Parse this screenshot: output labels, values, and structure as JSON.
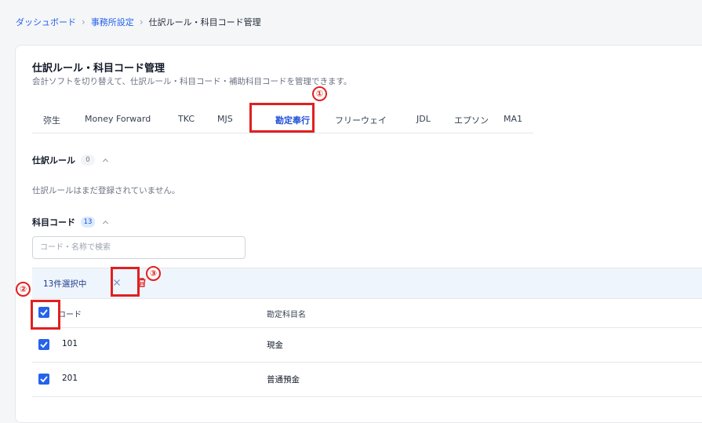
{
  "breadcrumb": {
    "items": [
      "ダッシュボード",
      "事務所設定",
      "仕訳ルール・科目コード管理"
    ],
    "separator": "›"
  },
  "page": {
    "title": "仕訳ルール・科目コード管理",
    "subtitle": "会計ソフトを切り替えて、仕訳ルール・科目コード・補助科目コードを管理できます。"
  },
  "tabs": [
    {
      "label": "弥生",
      "active": false
    },
    {
      "label": "Money Forward",
      "active": false
    },
    {
      "label": "TKC",
      "active": false
    },
    {
      "label": "MJS",
      "active": false
    },
    {
      "label": "勘定奉行",
      "active": true
    },
    {
      "label": "フリーウェイ",
      "active": false
    },
    {
      "label": "JDL",
      "active": false
    },
    {
      "label": "エプソン",
      "active": false
    },
    {
      "label": "MA1",
      "active": false
    }
  ],
  "rules_section": {
    "title": "仕訳ルール",
    "count": "0",
    "empty_text": "仕訳ルールはまだ登録されていません。"
  },
  "codes_section": {
    "title": "科目コード",
    "count": "13",
    "search_placeholder": "コード・名称で検索",
    "selection_text": "13件選択中",
    "columns": {
      "code": "コード",
      "name": "勘定科目名"
    },
    "rows": [
      {
        "code": "101",
        "name": "現金",
        "checked": true
      },
      {
        "code": "201",
        "name": "普通預金",
        "checked": true
      }
    ]
  },
  "annotations": [
    "①",
    "②",
    "③"
  ],
  "colors": {
    "accent": "#2563eb",
    "highlight": "#e02020",
    "selection_bar": "#eff5fc",
    "danger": "#dc2626"
  },
  "icons": [
    "chevron-right-icon",
    "chevron-up-icon",
    "close-icon",
    "trash-icon",
    "check-icon"
  ]
}
